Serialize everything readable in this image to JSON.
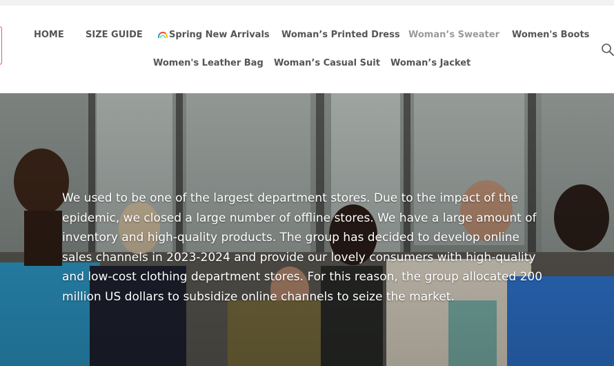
{
  "nav": {
    "row1": [
      {
        "label": "HOME"
      },
      {
        "label": "SIZE GUIDE"
      },
      {
        "label": "Spring New Arrivals",
        "icon": "rainbow-emoji-icon"
      },
      {
        "label": "Woman’s Printed Dress"
      },
      {
        "label": "Woman’s Sweater"
      },
      {
        "label": "Women's Boots"
      }
    ],
    "row2": [
      {
        "label": "Women's Leather Bag"
      },
      {
        "label": "Woman’s Casual Suit"
      },
      {
        "label": "Woman’s Jacket"
      }
    ],
    "search_icon": "search-icon"
  },
  "hero": {
    "text": "We used to be one of the largest department stores. Due to the impact of the epidemic, we closed a large number of offline stores. We have a large amount of inventory and high-quality products. The group has decided to develop online sales channels in 2023-2024 and provide our lovely consumers with high-quality and low-cost clothing department stores. For this reason, the group allocated 200 million US dollars to subsidize online channels to seize the market."
  },
  "colors": {
    "nav_text": "#555555",
    "nav_text_muted": "#9a9a9a",
    "logo_accent": "#e05a5a",
    "hero_text": "#ffffff"
  }
}
